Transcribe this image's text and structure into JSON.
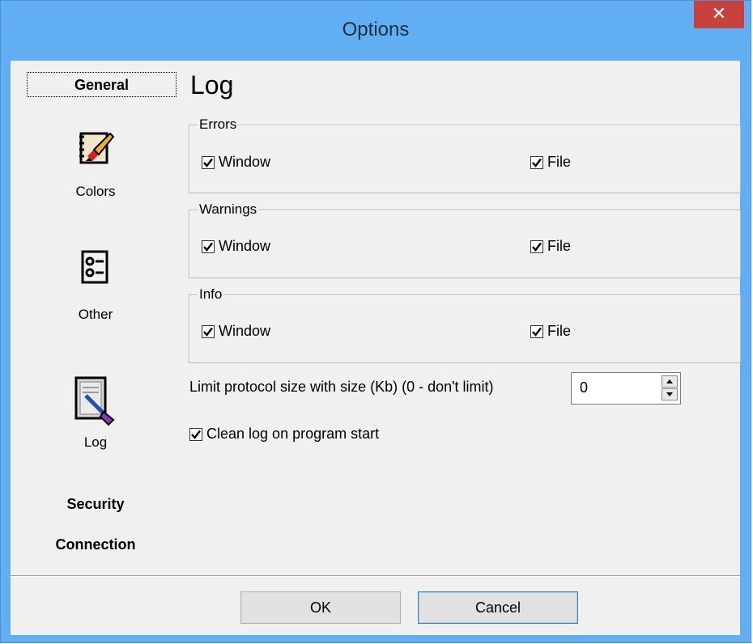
{
  "window": {
    "title": "Options",
    "close_glyph": "✕"
  },
  "sidebar": {
    "items": [
      {
        "label": "General",
        "style": "bold-text",
        "selected": true
      },
      {
        "label": "Colors",
        "icon": "colors-palette-icon"
      },
      {
        "label": "Other",
        "icon": "other-list-icon"
      },
      {
        "label": "Log",
        "icon": "log-document-icon"
      },
      {
        "label": "Security",
        "style": "bold-text"
      },
      {
        "label": "Connection",
        "style": "bold-text"
      }
    ]
  },
  "main": {
    "title": "Log",
    "groups": [
      {
        "legend": "Errors",
        "window_label": "Window",
        "window_checked": true,
        "file_label": "File",
        "file_checked": true
      },
      {
        "legend": "Warnings",
        "window_label": "Window",
        "window_checked": true,
        "file_label": "File",
        "file_checked": true
      },
      {
        "legend": "Info",
        "window_label": "Window",
        "window_checked": true,
        "file_label": "File",
        "file_checked": true
      }
    ],
    "limit_label": "Limit protocol size with size (Kb) (0 - don't limit)",
    "limit_value": "0",
    "clean_label": "Clean log on program start",
    "clean_checked": true
  },
  "buttons": {
    "ok": "OK",
    "cancel": "Cancel"
  },
  "colors": {
    "titlebar": "#62aef3",
    "close": "#c7423a",
    "client": "#f0f0f0"
  }
}
